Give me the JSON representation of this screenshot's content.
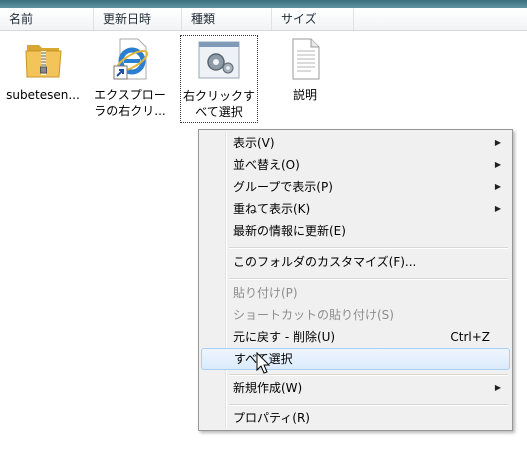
{
  "columns": [
    "名前",
    "更新日時",
    "種類",
    "サイズ"
  ],
  "files": [
    {
      "label_line1": "subetesen...",
      "label_line2": "",
      "icon": "zip-folder-icon"
    },
    {
      "label_line1": "エクスプロー",
      "label_line2": "ラの右クリ...",
      "icon": "internet-explorer-shortcut-icon"
    },
    {
      "label_line1": "右クリックす",
      "label_line2": "べて選択",
      "icon": "settings-file-icon"
    },
    {
      "label_line1": "説明",
      "label_line2": "",
      "icon": "text-document-icon"
    }
  ],
  "menu": {
    "view": "表示(V)",
    "sort": "並べ替え(O)",
    "group": "グループで表示(P)",
    "stack": "重ねて表示(K)",
    "refresh": "最新の情報に更新(E)",
    "customize": "このフォルダのカスタマイズ(F)...",
    "paste": "貼り付け(P)",
    "paste_shortcut": "ショートカットの貼り付け(S)",
    "undo": "元に戻す - 削除(U)",
    "undo_shortcut": "Ctrl+Z",
    "select_all": "すべて選択",
    "new": "新規作成(W)",
    "properties": "プロパティ(R)"
  },
  "colors": {
    "highlight": "#dcebfc",
    "disabled_text": "#8d8d8d"
  }
}
